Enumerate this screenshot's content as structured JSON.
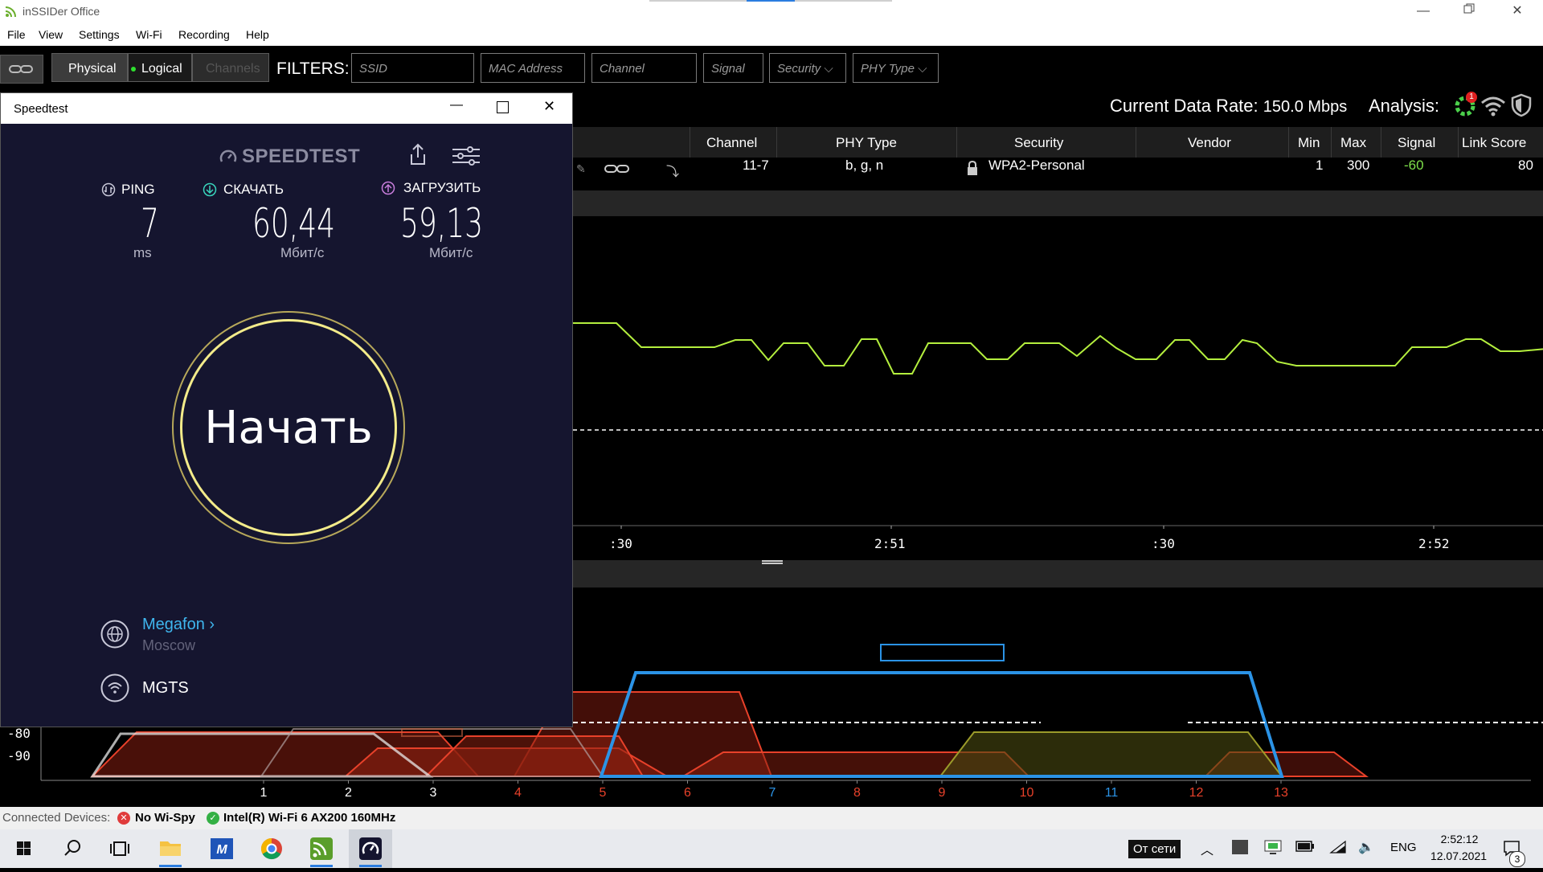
{
  "window": {
    "title": "inSSIDer Office"
  },
  "menu": {
    "items": [
      "File",
      "View",
      "Settings",
      "Wi-Fi",
      "Recording",
      "Help"
    ]
  },
  "toolbar": {
    "view_physical": "Physical",
    "view_logical": "Logical",
    "view_channels": "Channels",
    "filters_label": "FILTERS:",
    "filter_ssid_placeholder": "SSID",
    "filter_mac_placeholder": "MAC Address",
    "filter_channel_placeholder": "Channel",
    "filter_signal_placeholder": "Signal",
    "filter_security": "Security",
    "filter_phy": "PHY Type"
  },
  "status_line": {
    "data_rate_label": "Current Data Rate:",
    "data_rate_value": "150.0 Mbps",
    "analysis_label": "Analysis:",
    "analysis_badge": "1"
  },
  "table": {
    "headers": [
      "Channel",
      "PHY Type",
      "Security",
      "Vendor",
      "Min",
      "Max",
      "Signal",
      "Link Score"
    ],
    "row": {
      "channel": "11-7",
      "phy_type": "b, g, n",
      "security": "WPA2-Personal",
      "vendor": "",
      "min": "1",
      "max": "300",
      "signal": "-60",
      "link_score": "80"
    }
  },
  "time_chart": {
    "x_ticks": [
      ":30",
      "2:51",
      ":30",
      "2:52"
    ]
  },
  "channel_chart": {
    "y_ticks": [
      "-80",
      "-90"
    ],
    "channels": [
      {
        "label": "1",
        "color": "#ffffff"
      },
      {
        "label": "2",
        "color": "#ffffff"
      },
      {
        "label": "3",
        "color": "#ffffff"
      },
      {
        "label": "4",
        "color": "#e8412a"
      },
      {
        "label": "5",
        "color": "#e8412a"
      },
      {
        "label": "6",
        "color": "#e8412a"
      },
      {
        "label": "7",
        "color": "#2b93e6"
      },
      {
        "label": "8",
        "color": "#e8412a"
      },
      {
        "label": "9",
        "color": "#e8412a"
      },
      {
        "label": "10",
        "color": "#e8412a"
      },
      {
        "label": "11",
        "color": "#2b93e6"
      },
      {
        "label": "12",
        "color": "#e8412a"
      },
      {
        "label": "13",
        "color": "#e8412a"
      }
    ]
  },
  "speedtest": {
    "window_title": "Speedtest",
    "brand": "SPEEDTEST",
    "ping_label": "PING",
    "ping_value": "7",
    "ping_unit": "ms",
    "download_label": "СКАЧАТЬ",
    "download_value": "60,44",
    "download_unit": "Мбит/с",
    "upload_label": "ЗАГРУЗИТЬ",
    "upload_value": "59,13",
    "upload_unit": "Мбит/с",
    "start_label": "Начать",
    "server_name": "Megafon",
    "server_city": "Moscow",
    "isp": "MGTS"
  },
  "statusbar": {
    "connected_label": "Connected Devices:",
    "device1": "No Wi-Spy",
    "device2": "Intel(R) Wi-Fi 6 AX200 160MHz"
  },
  "taskbar": {
    "network_button": "От сети",
    "lang": "ENG",
    "time": "2:52:12",
    "date": "12.07.2021",
    "notif_count": "3"
  },
  "colors": {
    "accent_green": "#b4ef3e",
    "blue": "#2b93e6",
    "red": "#e8412a",
    "speedtest_bg": "#15152f"
  }
}
